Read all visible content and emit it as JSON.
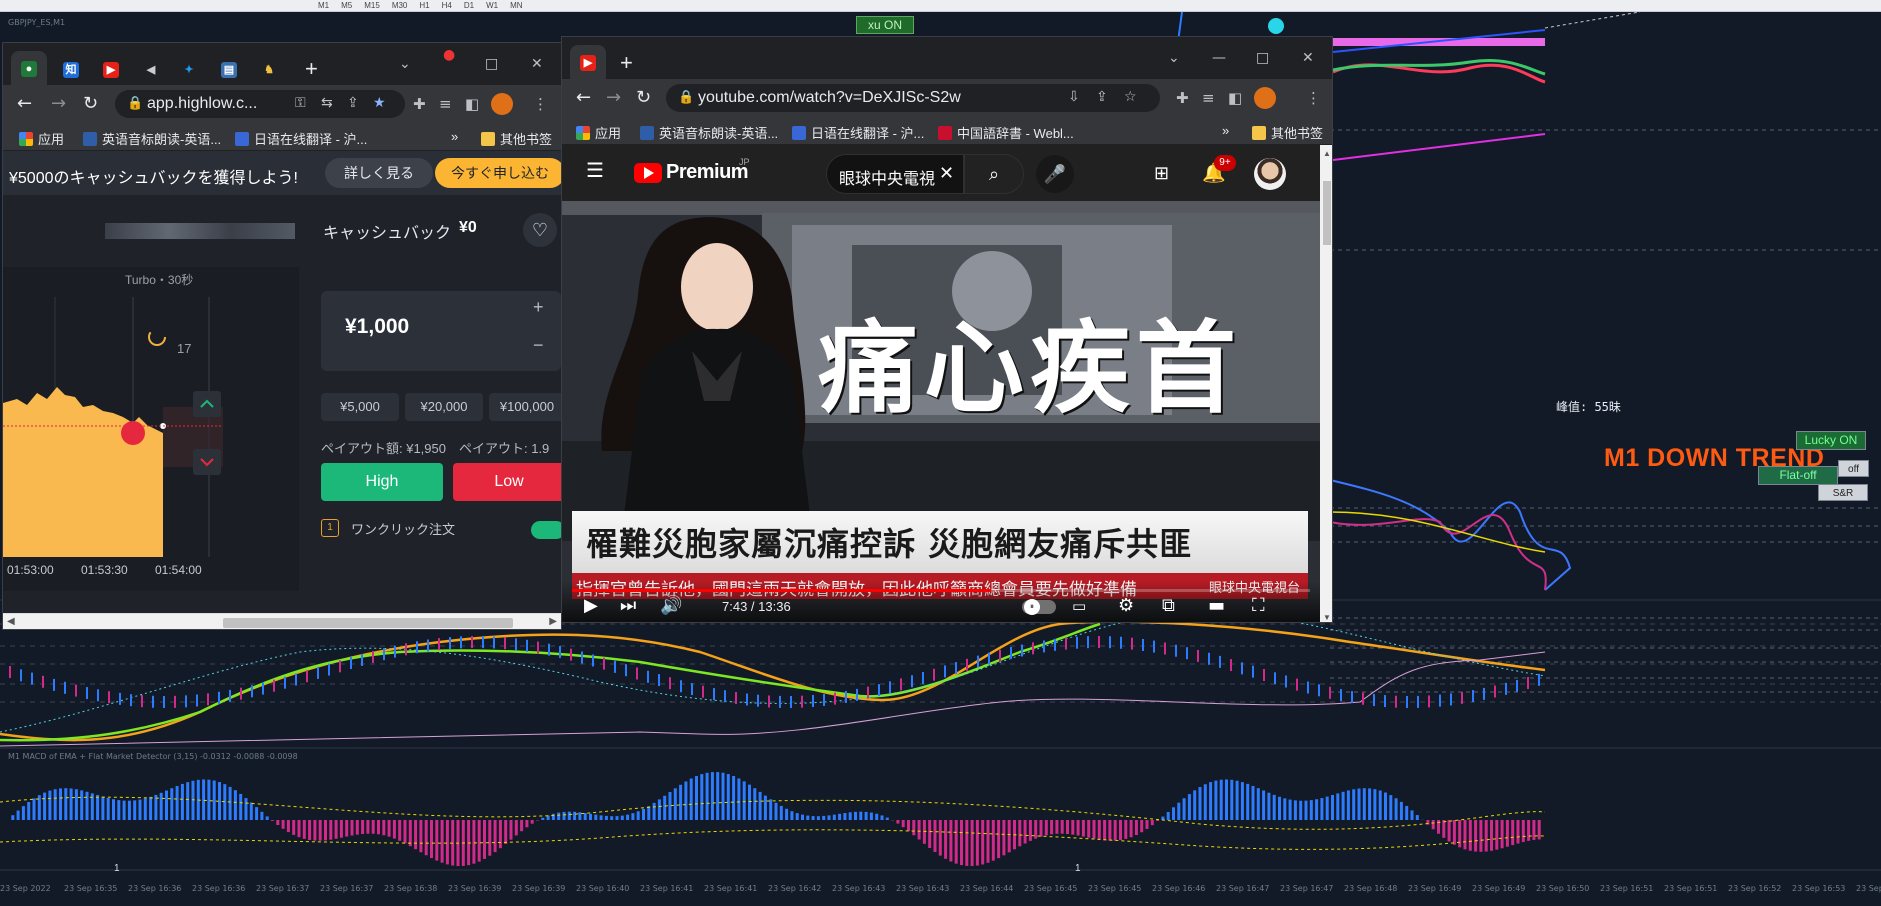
{
  "platform": {
    "symbol_label": "GBPJPY_ES,M1",
    "timeframes": [
      "M1",
      "M5",
      "M15",
      "M30",
      "H1",
      "H4",
      "D1",
      "W1",
      "MN"
    ],
    "xu_button": "xu ON",
    "peak_label": "峰值: 55昧",
    "trend_label": "M1 DOWN TREND",
    "lucky_button": "Lucky ON",
    "flat_button": "Flat-off",
    "off_button": "off",
    "sr_button": "S&R",
    "macd_label": "M1 MACD of EMA + Flat Market Detector (3,15) -0.0312 -0.0088 -0.0098",
    "marker_one_a": "1",
    "marker_one_b": "1",
    "time_axis": [
      "23 Sep 2022",
      "23 Sep 16:35",
      "23 Sep 16:36",
      "23 Sep 16:36",
      "23 Sep 16:37",
      "23 Sep 16:37",
      "23 Sep 16:38",
      "23 Sep 16:39",
      "23 Sep 16:39",
      "23 Sep 16:40",
      "23 Sep 16:41",
      "23 Sep 16:41",
      "23 Sep 16:42",
      "23 Sep 16:43",
      "23 Sep 16:43",
      "23 Sep 16:44",
      "23 Sep 16:45",
      "23 Sep 16:45",
      "23 Sep 16:46",
      "23 Sep 16:47",
      "23 Sep 16:47",
      "23 Sep 16:48",
      "23 Sep 16:49",
      "23 Sep 16:49",
      "23 Sep 16:50",
      "23 Sep 16:51",
      "23 Sep 16:51",
      "23 Sep 16:52",
      "23 Sep 16:53",
      "23 Sep 16:53"
    ]
  },
  "highlow_window": {
    "address": "app.highlow.c...",
    "bookmarks": [
      "应用",
      "英语音标朗读-英语...",
      "日语在线翻译 - 沪...",
      "其他书签"
    ],
    "more_bookmarks": "»",
    "banner_text": "¥5000のキャッシュバックを獲得しよう!",
    "details_button": "詳しく見る",
    "apply_button": "今すぐ申し込む",
    "cashback_label": "キャッシュバック",
    "cashback_value": "¥0",
    "turbo_label": "Turbo・30秒",
    "countdown": "17",
    "time_ticks": [
      "01:53:00",
      "01:53:30",
      "01:54:00"
    ],
    "amount": "¥1,000",
    "plus": "+",
    "minus": "−",
    "chips": [
      "¥5,000",
      "¥20,000",
      "¥100,000"
    ],
    "payout_text": "ペイアウト額: ¥1,950　ペイアウト: 1.9",
    "high_button": "High",
    "low_button": "Low",
    "oneclick_label": "ワンクリック注文",
    "oneclick_icon": "1"
  },
  "youtube_window": {
    "address": "youtube.com/watch?v=DeXJISc-S2w",
    "bookmarks": [
      "应用",
      "英语音标朗读-英语...",
      "日语在线翻译 - 沪...",
      "中国語辞書 - Webl...",
      "其他书签"
    ],
    "more_bookmarks": "»",
    "logo_text": "Premium",
    "logo_region": "JP",
    "search_value": "眼球中央電視",
    "notification_count": "9+",
    "video_big_title": "痛心疾首",
    "video_headline": "罹難災胞家屬沉痛控訴 災胞網友痛斥共匪",
    "video_ticker": "指揮官曾告訴他，國門這兩天就會開放，因此他呼籲商總會員要先做好準備",
    "video_channel": "眼球中央電視台",
    "time_display": "7:43 / 13:36",
    "progress_fraction": 0.568
  },
  "colors": {
    "accent_red": "#ff0000",
    "high_green": "#1bb879",
    "low_red": "#e6283f",
    "apply_yellow": "#fbb532",
    "trend_orange": "#ff5a12"
  }
}
